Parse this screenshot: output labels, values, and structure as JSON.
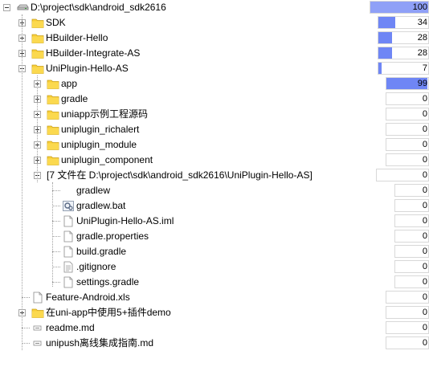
{
  "tree": {
    "rows": [
      {
        "label": "D:\\project\\sdk\\android_sdk2616",
        "value": "100",
        "pct": 100,
        "icon": "drive-icon",
        "expand": "minus",
        "level": 0
      },
      {
        "label": "SDK",
        "value": "34",
        "pct": 34,
        "icon": "folder-icon",
        "expand": "plus",
        "level": 1
      },
      {
        "label": "HBuilder-Hello",
        "value": "28",
        "pct": 28,
        "icon": "folder-icon",
        "expand": "plus",
        "level": 1
      },
      {
        "label": "HBuilder-Integrate-AS",
        "value": "28",
        "pct": 28,
        "icon": "folder-icon",
        "expand": "plus",
        "level": 1
      },
      {
        "label": "UniPlugin-Hello-AS",
        "value": "7",
        "pct": 7,
        "icon": "folder-icon",
        "expand": "minus",
        "level": 1
      },
      {
        "label": "app",
        "value": "99",
        "pct": 99,
        "icon": "folder-icon",
        "expand": "plus",
        "level": 2
      },
      {
        "label": "gradle",
        "value": "0",
        "pct": 0,
        "icon": "folder-icon",
        "expand": "plus",
        "level": 2
      },
      {
        "label": "uniapp示例工程源码",
        "value": "0",
        "pct": 0,
        "icon": "folder-icon",
        "expand": "plus",
        "level": 2
      },
      {
        "label": "uniplugin_richalert",
        "value": "0",
        "pct": 0,
        "icon": "folder-icon",
        "expand": "plus",
        "level": 2
      },
      {
        "label": "uniplugin_module",
        "value": "0",
        "pct": 0,
        "icon": "folder-icon",
        "expand": "plus",
        "level": 2
      },
      {
        "label": "uniplugin_component",
        "value": "0",
        "pct": 0,
        "icon": "folder-icon",
        "expand": "plus",
        "level": 2
      },
      {
        "label": "[7 文件在 D:\\project\\sdk\\android_sdk2616\\UniPlugin-Hello-AS]",
        "value": "0",
        "pct": 0,
        "icon": "files-group-icon",
        "expand": "minus",
        "level": 2
      },
      {
        "label": "gradlew",
        "value": "0",
        "pct": 0,
        "icon": "none",
        "expand": "none",
        "level": 3
      },
      {
        "label": "gradlew.bat",
        "value": "0",
        "pct": 0,
        "icon": "batch-file-icon",
        "expand": "none",
        "level": 3
      },
      {
        "label": "UniPlugin-Hello-AS.iml",
        "value": "0",
        "pct": 0,
        "icon": "file-icon",
        "expand": "none",
        "level": 3
      },
      {
        "label": "gradle.properties",
        "value": "0",
        "pct": 0,
        "icon": "file-icon",
        "expand": "none",
        "level": 3
      },
      {
        "label": "build.gradle",
        "value": "0",
        "pct": 0,
        "icon": "file-icon",
        "expand": "none",
        "level": 3
      },
      {
        "label": ".gitignore",
        "value": "0",
        "pct": 0,
        "icon": "text-file-icon",
        "expand": "none",
        "level": 3
      },
      {
        "label": "settings.gradle",
        "value": "0",
        "pct": 0,
        "icon": "file-icon",
        "expand": "none",
        "level": 3
      },
      {
        "label": "Feature-Android.xls",
        "value": "0",
        "pct": 0,
        "icon": "file-icon",
        "expand": "none",
        "level": 1
      },
      {
        "label": "在uni-app中使用5+插件demo",
        "value": "0",
        "pct": 0,
        "icon": "folder-icon",
        "expand": "plus",
        "level": 1
      },
      {
        "label": "readme.md",
        "value": "0",
        "pct": 0,
        "icon": "markdown-file-icon",
        "expand": "none",
        "level": 1
      },
      {
        "label": "unipush离线集成指南.md",
        "value": "0",
        "pct": 0,
        "icon": "markdown-file-icon",
        "expand": "none",
        "level": 1
      }
    ]
  },
  "colors": {
    "bar": "#6f86f5",
    "folder": "#f5c518",
    "guide": "#a0a0a0"
  }
}
